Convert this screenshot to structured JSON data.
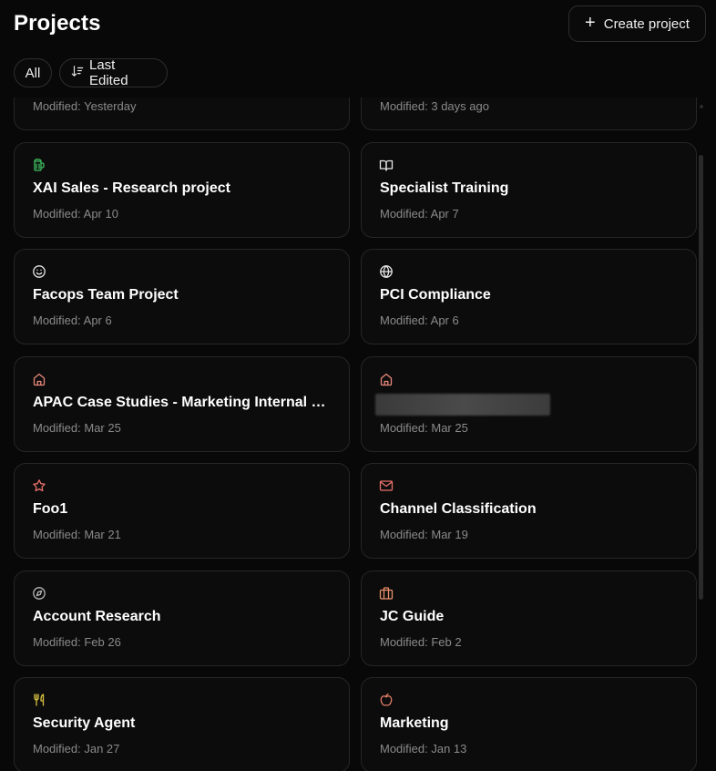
{
  "header": {
    "title": "Projects",
    "create_label": "Create project"
  },
  "filters": {
    "all_label": "All",
    "sort_label": "Last Edited"
  },
  "projects": [
    {
      "name": "",
      "modified": "Modified: Yesterday",
      "icon": "none",
      "color": ""
    },
    {
      "name": "",
      "modified": "Modified: 3 days ago",
      "icon": "none",
      "color": ""
    },
    {
      "name": "XAI Sales - Research project",
      "modified": "Modified: Apr 10",
      "icon": "beer-mug-icon",
      "color": "#3fbf5f"
    },
    {
      "name": "Specialist Training",
      "modified": "Modified: Apr 7",
      "icon": "book-open-icon",
      "color": "#e8e8e8"
    },
    {
      "name": "Facops Team Project",
      "modified": "Modified: Apr 6",
      "icon": "smiley-icon",
      "color": "#e8e8e8"
    },
    {
      "name": "PCI Compliance",
      "modified": "Modified: Apr 6",
      "icon": "globe-icon",
      "color": "#e8e8e8"
    },
    {
      "name": "APAC Case Studies - Marketing Internal Resources",
      "modified": "Modified: Mar 25",
      "icon": "home-icon",
      "color": "#e8877a"
    },
    {
      "name": "",
      "modified": "Modified: Mar 25",
      "icon": "home-icon",
      "color": "#e8877a",
      "redacted": true
    },
    {
      "name": "Foo1",
      "modified": "Modified: Mar 21",
      "icon": "star-icon",
      "color": "#e8706a"
    },
    {
      "name": "Channel Classification",
      "modified": "Modified: Mar 19",
      "icon": "mail-icon",
      "color": "#e8706a"
    },
    {
      "name": "Account Research",
      "modified": "Modified: Feb 26",
      "icon": "compass-icon",
      "color": "#b8b8b8"
    },
    {
      "name": "JC Guide",
      "modified": "Modified: Feb 2",
      "icon": "briefcase-icon",
      "color": "#e8906a"
    },
    {
      "name": "Security Agent",
      "modified": "Modified: Jan 27",
      "icon": "utensils-icon",
      "color": "#d8c240"
    },
    {
      "name": "Marketing",
      "modified": "Modified: Jan 13",
      "icon": "apple-icon",
      "color": "#e8806a"
    }
  ]
}
